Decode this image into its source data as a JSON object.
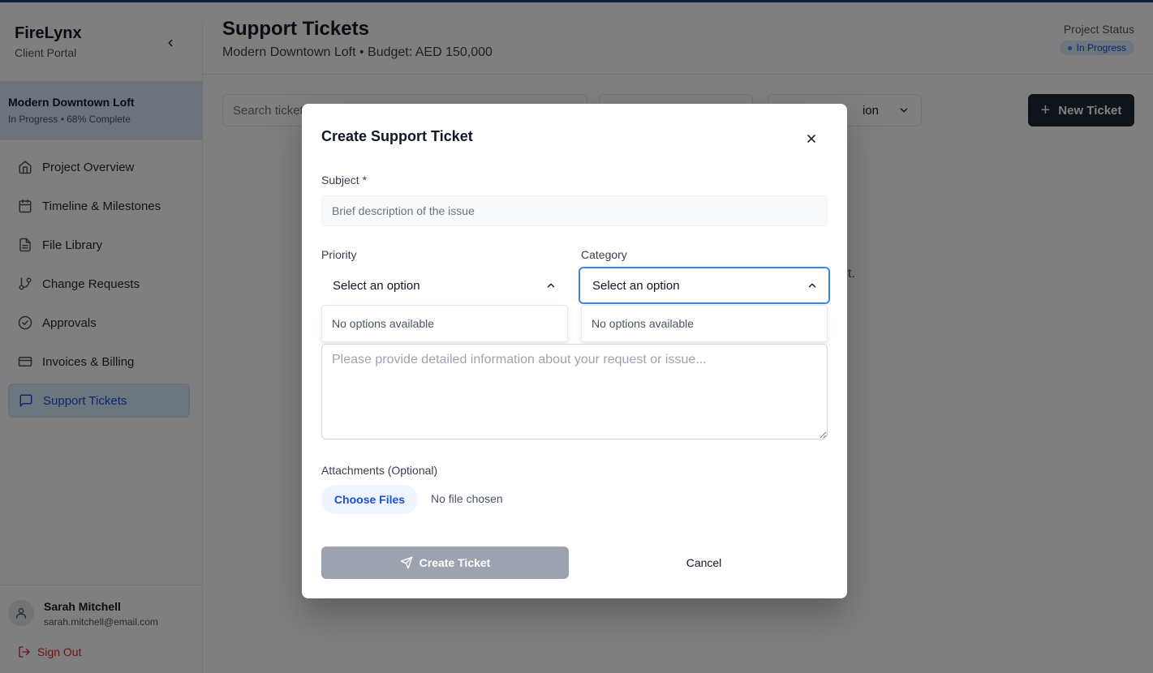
{
  "sidebar": {
    "brand_name": "FireLynx",
    "brand_sub": "Client Portal",
    "project": {
      "name": "Modern Downtown Loft",
      "status_line": "In Progress • 68% Complete"
    },
    "items": [
      {
        "label": "Project Overview",
        "icon": "home-icon"
      },
      {
        "label": "Timeline & Milestones",
        "icon": "calendar-icon"
      },
      {
        "label": "File Library",
        "icon": "file-icon"
      },
      {
        "label": "Change Requests",
        "icon": "git-branch-icon"
      },
      {
        "label": "Approvals",
        "icon": "check-circle-icon"
      },
      {
        "label": "Invoices & Billing",
        "icon": "credit-card-icon"
      },
      {
        "label": "Support Tickets",
        "icon": "message-square-icon",
        "active": true
      }
    ],
    "user": {
      "name": "Sarah Mitchell",
      "email": "sarah.mitchell@email.com"
    },
    "sign_out": "Sign Out"
  },
  "header": {
    "title": "Support Tickets",
    "subtitle": "Modern Downtown Loft • Budget: AED 150,000",
    "status_label": "Project Status",
    "status_badge": "In Progress"
  },
  "toolbar": {
    "search_placeholder": "Search tickets...",
    "filter2_partial_label": "ion",
    "new_ticket_label": "New Ticket"
  },
  "empty_state_partial": "roject.",
  "modal": {
    "title": "Create Support Ticket",
    "subject_label": "Subject *",
    "subject_placeholder": "Brief description of the issue",
    "priority_label": "Priority",
    "priority_value": "Select an option",
    "category_label": "Category",
    "category_value": "Select an option",
    "no_options": "No options available",
    "description_placeholder": "Please provide detailed information about your request or issue...",
    "attachments_label": "Attachments (Optional)",
    "choose_files": "Choose Files",
    "no_file": "No file chosen",
    "create_label": "Create Ticket",
    "cancel_label": "Cancel"
  },
  "colors": {
    "accent": "#1e3a8a",
    "active_nav_bg": "#dbeafe",
    "active_text": "#1d4ed8",
    "primary_dark": "#1f2937",
    "disabled_button": "#9ca3af",
    "danger": "#dc2626",
    "focus_ring": "#3b82f6"
  }
}
